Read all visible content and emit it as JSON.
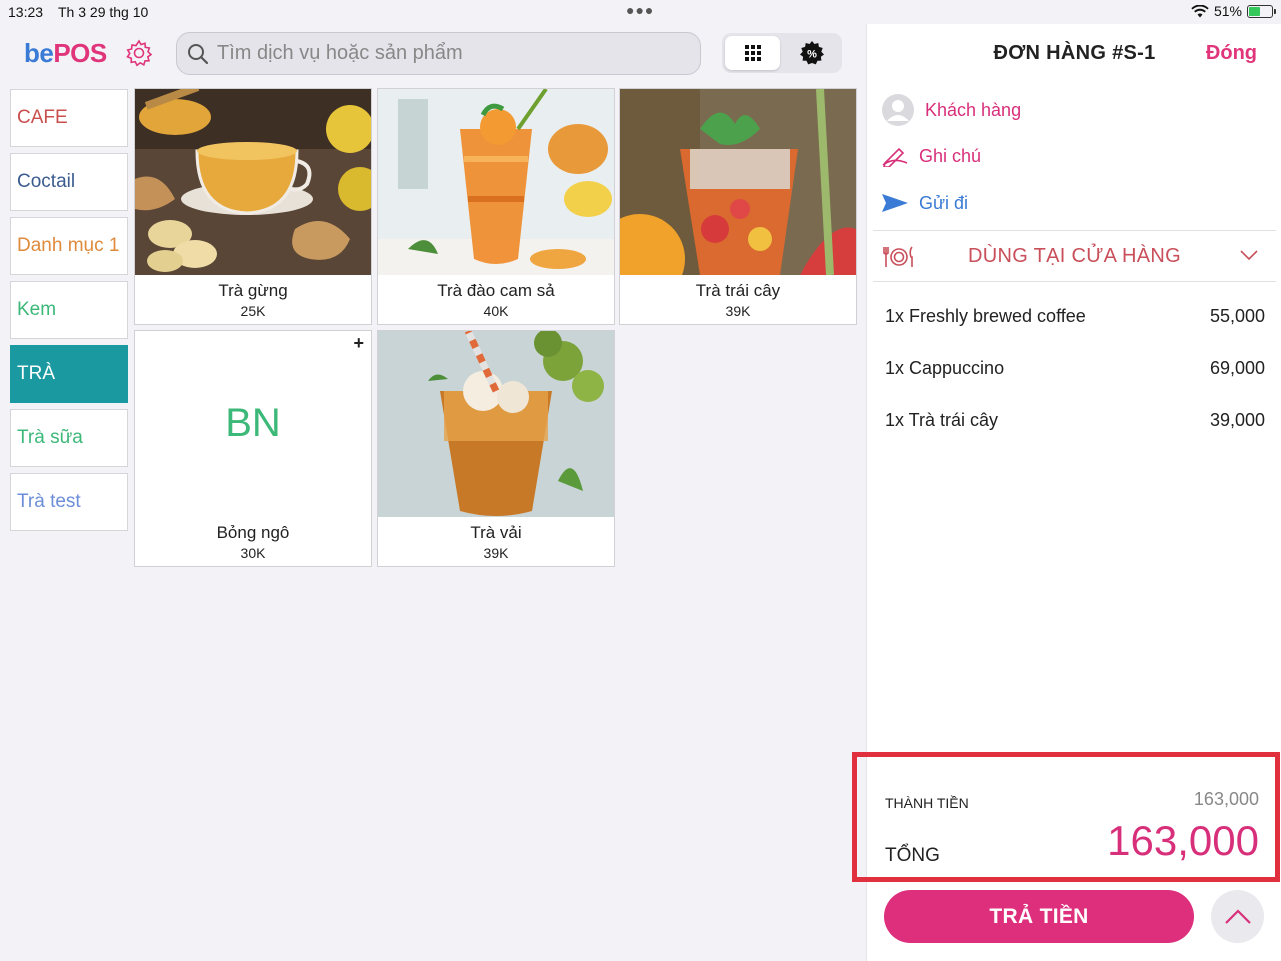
{
  "status_bar": {
    "time": "13:23",
    "date": "Th 3 29 thg 10",
    "battery": "51%",
    "battery_level": 0.51
  },
  "brand": {
    "part1": "be",
    "part2": "POS"
  },
  "search": {
    "placeholder": "Tìm dịch vụ hoặc sản phẩm"
  },
  "categories": [
    {
      "label": "CAFE",
      "color": "#c94f4f"
    },
    {
      "label": "Coctail",
      "color": "#3b5b8f"
    },
    {
      "label": "Danh mục 1",
      "color": "#e08a3c"
    },
    {
      "label": "Kem",
      "color": "#3cb878"
    },
    {
      "label": "TRÀ",
      "color": "#ffffff",
      "active": true
    },
    {
      "label": "Trà sữa",
      "color": "#3cb878"
    },
    {
      "label": "Trà test",
      "color": "#6c8ed8"
    }
  ],
  "products": [
    {
      "name": "Trà gừng",
      "price": "25K",
      "image": "ginger-tea-photo"
    },
    {
      "name": "Trà đào cam sả",
      "price": "40K",
      "image": "peach-orange-tea-photo"
    },
    {
      "name": "Trà trái cây",
      "price": "39K",
      "image": "fruit-tea-photo"
    },
    {
      "name": "Bỏng ngô",
      "price": "30K",
      "initials": "BN"
    },
    {
      "name": "Trà vải",
      "price": "39K",
      "image": "lychee-tea-photo"
    }
  ],
  "order": {
    "title": "ĐƠN HÀNG #S-1",
    "close_label": "Đóng",
    "customer_label": "Khách hàng",
    "note_label": "Ghi chú",
    "send_label": "Gửi đi",
    "dining_option": "DÙNG TẠI CỬA HÀNG",
    "lines": [
      {
        "label": "1x Freshly brewed coffee",
        "amount": "55,000"
      },
      {
        "label": "1x Cappuccino",
        "amount": "69,000"
      },
      {
        "label": "1x Trà trái cây",
        "amount": "39,000"
      }
    ],
    "subtotal_label": "THÀNH TIỀN",
    "subtotal_value": "163,000",
    "total_label": "TỔNG",
    "total_value": "163,000",
    "pay_label": "TRẢ TIỀN"
  },
  "colors": {
    "accent": "#dd2f7c",
    "teal": "#1a9aa0",
    "highlight": "#e0303d"
  }
}
